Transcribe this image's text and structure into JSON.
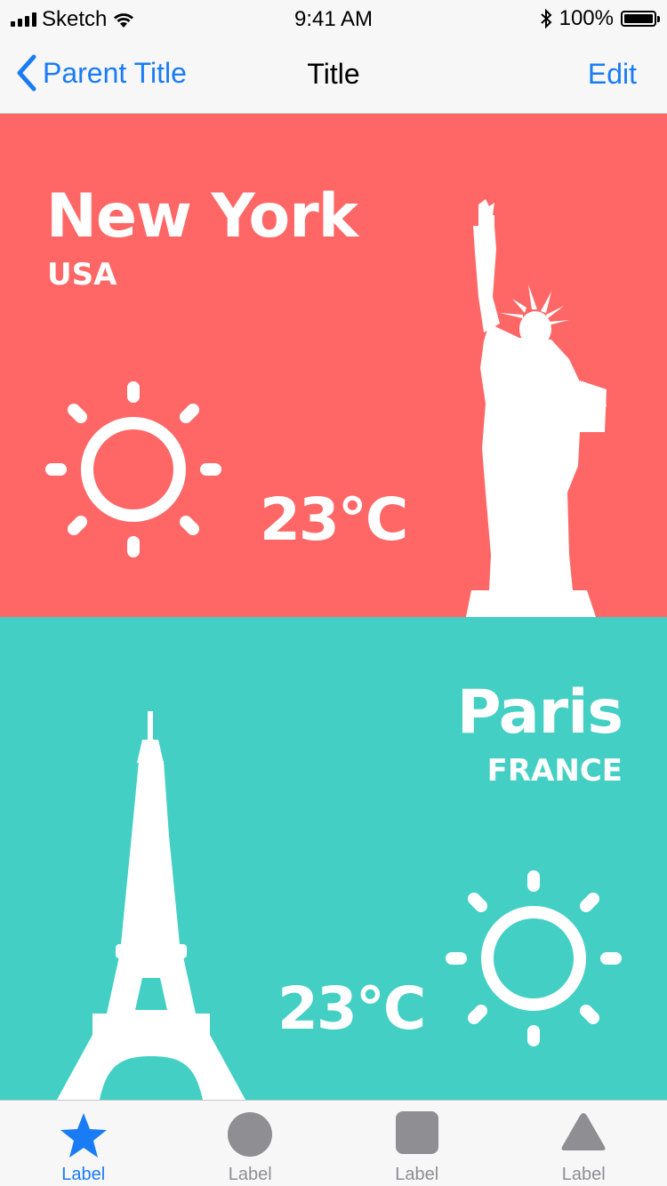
{
  "status_bar": {
    "carrier": "Sketch",
    "time": "9:41 AM",
    "battery": "100%"
  },
  "nav": {
    "back_label": "Parent Title",
    "title": "Title",
    "edit_label": "Edit"
  },
  "cities": [
    {
      "name": "New York",
      "country": "USA",
      "temperature": "23°C",
      "background": "#ff6767",
      "weather_icon": "sun-icon",
      "landmark": "statue-of-liberty"
    },
    {
      "name": "Paris",
      "country": "FRANCE",
      "temperature": "23°C",
      "background": "#43cfc4",
      "weather_icon": "sun-icon",
      "landmark": "eiffel-tower"
    }
  ],
  "tabs": [
    {
      "label": "Label",
      "icon": "star-icon",
      "active": true
    },
    {
      "label": "Label",
      "icon": "circle-icon",
      "active": false
    },
    {
      "label": "Label",
      "icon": "square-icon",
      "active": false
    },
    {
      "label": "Label",
      "icon": "triangle-icon",
      "active": false
    }
  ],
  "colors": {
    "accent": "#1a7cf5",
    "inactive": "#8e8e93"
  }
}
